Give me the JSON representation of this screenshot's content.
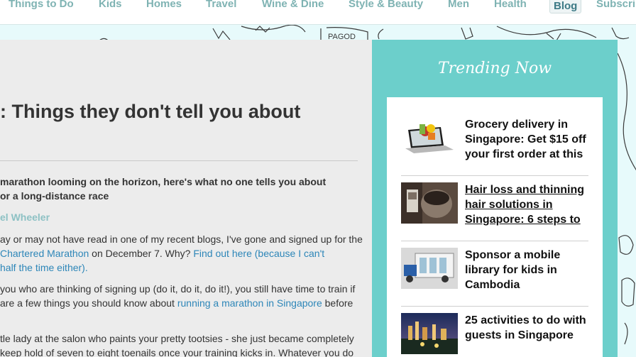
{
  "nav": {
    "items": [
      "Things to Do",
      "Kids",
      "Homes",
      "Travel",
      "Wine & Dine",
      "Style & Beauty",
      "Men",
      "Health",
      "Blog",
      "Subscrib"
    ],
    "active": "Blog"
  },
  "article": {
    "headline": ": Things they don't tell you about",
    "standfirst": [
      "marathon looming on the horizon, here's what no one tells you about",
      "or a long-distance race"
    ],
    "author": "el Wheeler",
    "p1": {
      "l1": "ay or may not have read in one of my recent blogs, I've gone and signed up for the",
      "l2_link1": "Chartered Marathon",
      "l2_text": " on December 7. Why? ",
      "l2_link2": "Find out here (because I can't",
      "l3_link": " half the time either)."
    },
    "p2": {
      "l1": " you who are thinking of signing up (do it, do it, do it!), you still have time to train if",
      "l2_text": "are a few things you should know about ",
      "l2_link": "running a marathon in Singapore",
      "l2_end": " before"
    },
    "p3": {
      "l1": "tle lady at the salon who paints your pretty tootsies - she just became completely",
      "l2": " keep hold of seven to eight toenails once your training kicks in. Whatever you do"
    }
  },
  "trending": {
    "title": "Trending Now",
    "items": [
      {
        "title": "Grocery delivery in Singapore: Get $15 off your first order at this"
      },
      {
        "title": "Hair loss and thinning hair solutions in Singapore: 6 steps to"
      },
      {
        "title": "Sponsor a mobile library for kids in Cambodia"
      },
      {
        "title": "25 activities to do with guests in Singapore"
      }
    ]
  },
  "colors": {
    "sidebar": "#6ccfcb",
    "link": "#2d86b8",
    "nav_text": "#7fb3b3"
  }
}
